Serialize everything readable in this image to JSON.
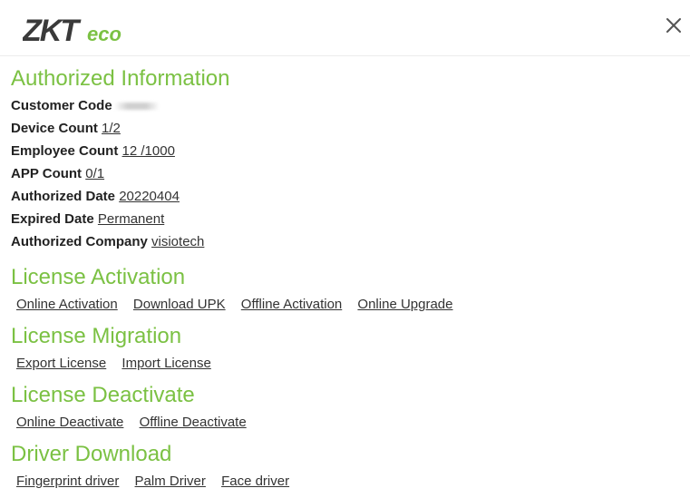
{
  "brand": {
    "logo_text_main": "ZKT",
    "logo_text_accent": "eco",
    "logo_color_dark": "#3a3a3a",
    "logo_color_accent": "#7bc143"
  },
  "colors": {
    "heading": "#7bc143",
    "text": "#333333"
  },
  "authorized_information": {
    "title": "Authorized Information",
    "customer_code": {
      "label": "Customer Code",
      "value": ""
    },
    "device_count": {
      "label": "Device Count",
      "value": "1/2"
    },
    "employee_count": {
      "label": "Employee Count",
      "value": "12 /1000"
    },
    "app_count": {
      "label": "APP Count",
      "value": "0/1"
    },
    "authorized_date": {
      "label": "Authorized Date",
      "value": "20220404"
    },
    "expired_date": {
      "label": "Expired Date",
      "value": "Permanent"
    },
    "authorized_company": {
      "label": "Authorized Company",
      "value": "visiotech"
    }
  },
  "license_activation": {
    "title": "License Activation",
    "links": [
      "Online Activation",
      "Download UPK",
      "Offline Activation",
      "Online Upgrade"
    ]
  },
  "license_migration": {
    "title": "License Migration",
    "links": [
      "Export License",
      "Import License"
    ]
  },
  "license_deactivate": {
    "title": "License Deactivate",
    "links": [
      "Online Deactivate",
      "Offline Deactivate"
    ]
  },
  "driver_download": {
    "title": "Driver Download",
    "links": [
      "Fingerprint driver",
      "Palm Driver",
      "Face driver"
    ]
  },
  "icons": {
    "close": "close-icon"
  }
}
